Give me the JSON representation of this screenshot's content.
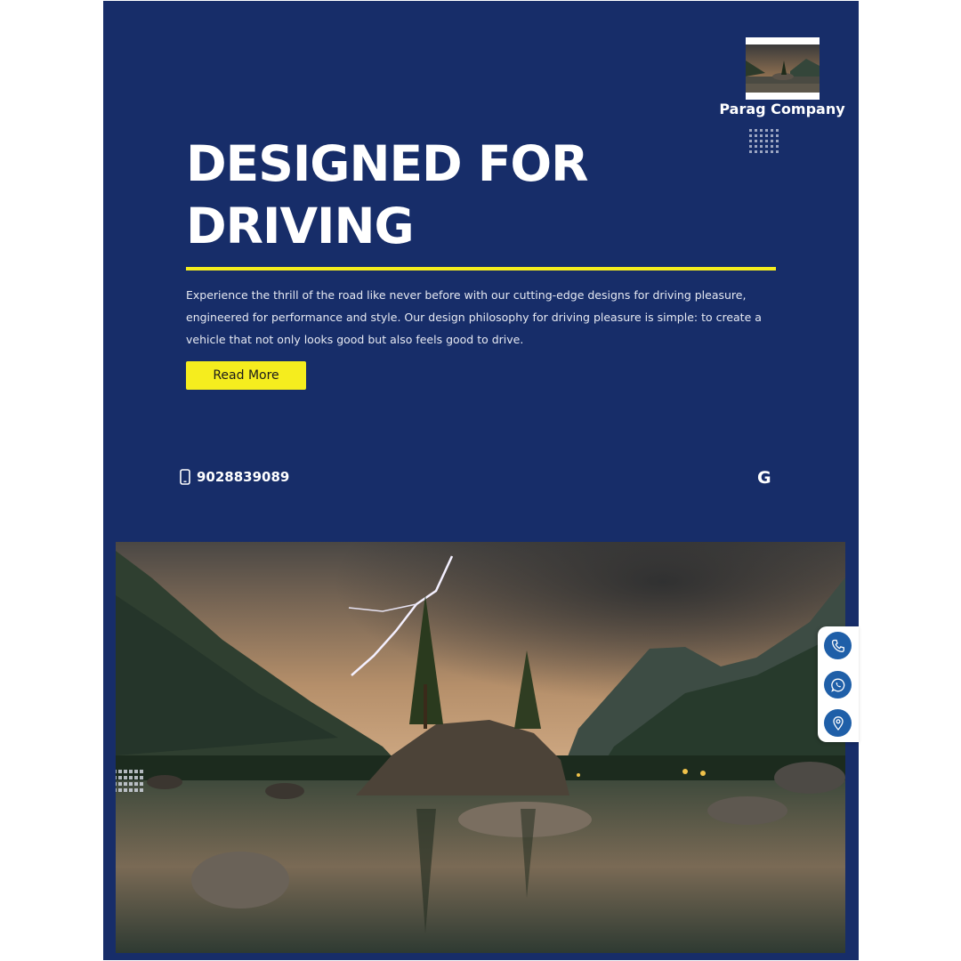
{
  "brand": {
    "name": "Parag Company"
  },
  "hero": {
    "title_line1": "DESIGNED FOR",
    "title_line2": "DRIVING",
    "description": "Experience the thrill of the road like never before with our cutting-edge designs for driving pleasure, engineered for performance and style. Our design philosophy for driving pleasure is simple: to create a vehicle that not only looks good but also feels good to drive.",
    "button_label": "Read More"
  },
  "contact": {
    "phone": "9028839089",
    "google_label": "G"
  },
  "floating_bar": {
    "icons": [
      "phone-icon",
      "whatsapp-icon",
      "location-pin-icon"
    ]
  },
  "colors": {
    "background": "#172d69",
    "accent": "#f5ed1e",
    "float_button": "#1f5fa8"
  }
}
